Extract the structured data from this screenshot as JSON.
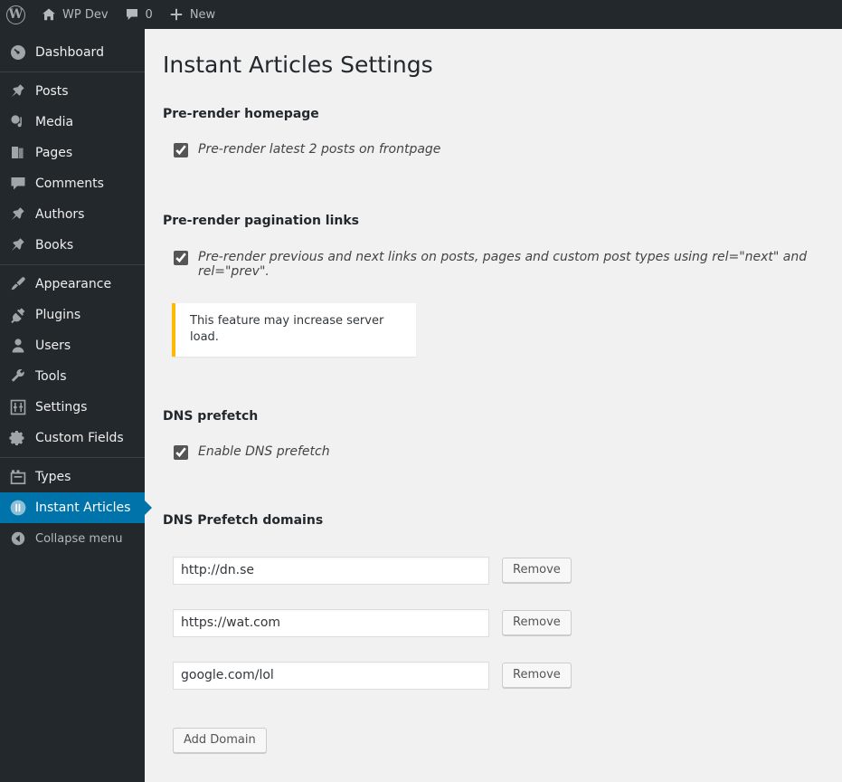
{
  "adminbar": {
    "wp_logo": "wordpress-logo",
    "site_name": "WP Dev",
    "comment_count": "0",
    "new_label": "New"
  },
  "sidebar": {
    "items": [
      {
        "label": "Dashboard",
        "icon": "dashboard-icon",
        "current": false,
        "sep_after": true
      },
      {
        "label": "Posts",
        "icon": "pin-icon",
        "current": false,
        "sep_after": false
      },
      {
        "label": "Media",
        "icon": "media-icon",
        "current": false,
        "sep_after": false
      },
      {
        "label": "Pages",
        "icon": "page-icon",
        "current": false,
        "sep_after": false
      },
      {
        "label": "Comments",
        "icon": "comment-icon",
        "current": false,
        "sep_after": false
      },
      {
        "label": "Authors",
        "icon": "pin-icon",
        "current": false,
        "sep_after": false
      },
      {
        "label": "Books",
        "icon": "pin-icon",
        "current": false,
        "sep_after": true
      },
      {
        "label": "Appearance",
        "icon": "paintbrush-icon",
        "current": false,
        "sep_after": false
      },
      {
        "label": "Plugins",
        "icon": "plug-icon",
        "current": false,
        "sep_after": false
      },
      {
        "label": "Users",
        "icon": "user-icon",
        "current": false,
        "sep_after": false
      },
      {
        "label": "Tools",
        "icon": "wrench-icon",
        "current": false,
        "sep_after": false
      },
      {
        "label": "Settings",
        "icon": "sliders-icon",
        "current": false,
        "sep_after": false
      },
      {
        "label": "Custom Fields",
        "icon": "gear-icon",
        "current": false,
        "sep_after": true
      },
      {
        "label": "Types",
        "icon": "archive-icon",
        "current": false,
        "sep_after": false
      },
      {
        "label": "Instant Articles",
        "icon": "instant-articles-icon",
        "current": true,
        "sep_after": false
      }
    ],
    "collapse": {
      "label": "Collapse menu",
      "icon": "collapse-arrow-icon"
    }
  },
  "page": {
    "title": "Instant Articles Settings",
    "sections": {
      "prerender_home": {
        "heading": "Pre-render homepage",
        "checkbox_label": "Pre-render latest 2 posts on frontpage",
        "checked": true
      },
      "pagination": {
        "heading": "Pre-render pagination links",
        "checkbox_label": "Pre-render previous and next links on posts, pages and custom post types using rel=\"next\" and rel=\"prev\".",
        "checked": true,
        "notice": "This feature may increase server load."
      },
      "dns_prefetch": {
        "heading": "DNS prefetch",
        "checkbox_label": "Enable DNS prefetch",
        "checked": true
      },
      "dns_domains": {
        "heading": "DNS Prefetch domains",
        "remove_label": "Remove",
        "add_label": "Add Domain",
        "domains": [
          {
            "value": "http://dn.se"
          },
          {
            "value": "https://wat.com"
          },
          {
            "value": "google.com/lol"
          }
        ]
      }
    }
  },
  "colors": {
    "admin_dark": "#23282d",
    "accent_blue": "#0073aa",
    "notice_warning": "#ffb900",
    "page_bg": "#f1f1f1"
  }
}
